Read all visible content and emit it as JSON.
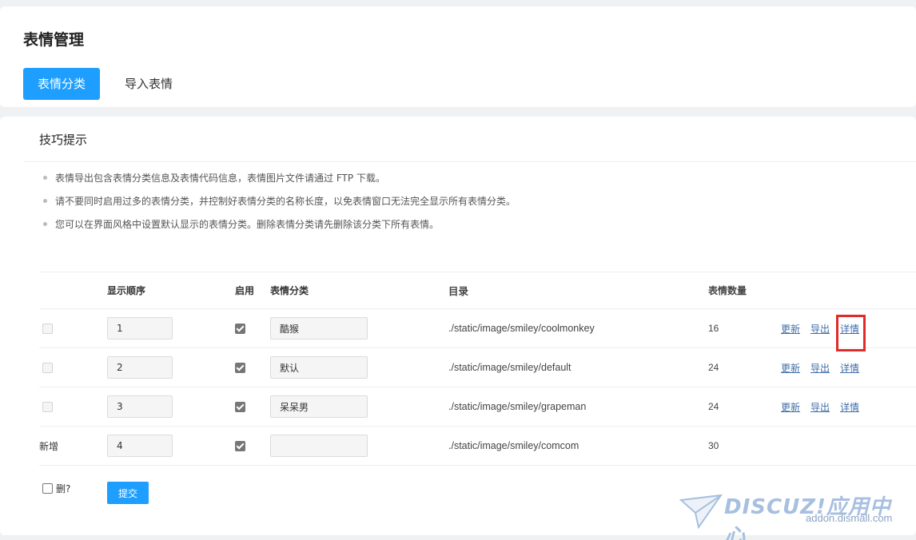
{
  "page": {
    "title": "表情管理"
  },
  "tabs": [
    {
      "label": "表情分类",
      "active": true
    },
    {
      "label": "导入表情",
      "active": false
    }
  ],
  "tips": {
    "title": "技巧提示",
    "items": [
      "表情导出包含表情分类信息及表情代码信息，表情图片文件请通过 FTP 下载。",
      "请不要同时启用过多的表情分类，并控制好表情分类的名称长度，以免表情窗口无法完全显示所有表情分类。",
      "您可以在界面风格中设置默认显示的表情分类。删除表情分类请先删除该分类下所有表情。"
    ]
  },
  "table": {
    "headers": {
      "order": "显示顺序",
      "enabled": "启用",
      "category": "表情分类",
      "directory": "目录",
      "count": "表情数量"
    },
    "rows": [
      {
        "order": "1",
        "enabled": true,
        "name": "酷猴",
        "directory": "./static/image/smiley/coolmonkey",
        "count": "16",
        "ops": [
          "更新",
          "导出",
          "详情"
        ]
      },
      {
        "order": "2",
        "enabled": true,
        "name": "默认",
        "directory": "./static/image/smiley/default",
        "count": "24",
        "ops": [
          "更新",
          "导出",
          "详情"
        ]
      },
      {
        "order": "3",
        "enabled": true,
        "name": "呆呆男",
        "directory": "./static/image/smiley/grapeman",
        "count": "24",
        "ops": [
          "更新",
          "导出",
          "详情"
        ]
      }
    ],
    "new_row": {
      "label": "新增",
      "order": "4",
      "enabled": true,
      "name": "",
      "directory": "./static/image/smiley/comcom",
      "count": "30"
    }
  },
  "footer": {
    "delete_label": "删?",
    "submit_label": "提交"
  },
  "watermark": {
    "logo": "DISCUZ!应用中心",
    "url": "addon.dismall.com"
  },
  "colors": {
    "accent": "#1e9fff",
    "link": "#3f6ea8",
    "highlight": "#e02b2b"
  }
}
